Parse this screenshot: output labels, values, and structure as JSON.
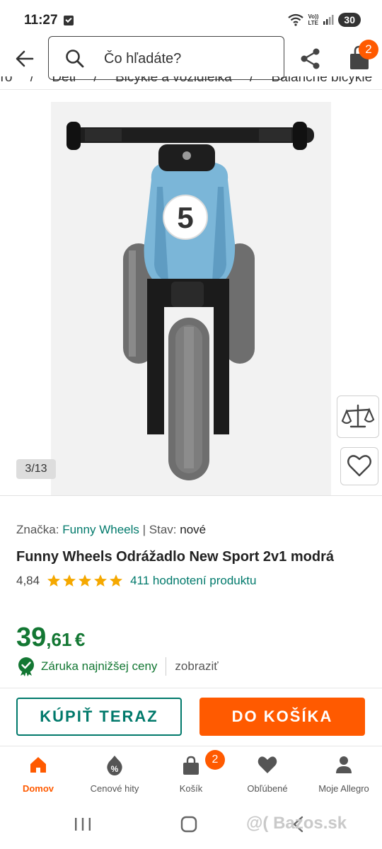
{
  "status_bar": {
    "time": "11:27",
    "volte_top": "Vo))",
    "volte_bottom": "LTE",
    "battery": "30"
  },
  "search": {
    "placeholder": "Čo hľadáte?"
  },
  "cart": {
    "badge": "2"
  },
  "breadcrumb": {
    "items": [
      "gro",
      "Deti",
      "Bicykle a vozidielka",
      "Balančné bicykle"
    ],
    "separator": "/"
  },
  "gallery": {
    "counter": "3/13",
    "number_plate": "5"
  },
  "product": {
    "brand_label": "Značka:",
    "brand": "Funny Wheels",
    "state_label": "| Stav:",
    "state": "nové",
    "title": "Funny Wheels Odrážadlo New Sport 2v1 modrá",
    "rating": "4,84",
    "stars": 5,
    "reviews_link": "411 hodnotení produktu",
    "price_int": "39",
    "price_dec": ",61",
    "price_currency": "€",
    "guarantee": "Záruka najnižšej ceny",
    "guarantee_show": "zobraziť"
  },
  "actions": {
    "buy_now": "KÚPIŤ TERAZ",
    "add_to_cart": "DO KOŠÍKA"
  },
  "bottom_nav": {
    "items": [
      {
        "label": "Domov",
        "icon": "home-icon"
      },
      {
        "label": "Cenové hity",
        "icon": "percent-tag-icon"
      },
      {
        "label": "Košík",
        "icon": "bag-icon"
      },
      {
        "label": "Obľúbené",
        "icon": "heart-icon"
      },
      {
        "label": "Moje Allegro",
        "icon": "person-icon"
      }
    ],
    "cart_badge": "2"
  },
  "watermark": "@( Bazos.sk",
  "colors": {
    "accent": "#ff5a00",
    "link": "#00796b",
    "price": "#137733"
  }
}
